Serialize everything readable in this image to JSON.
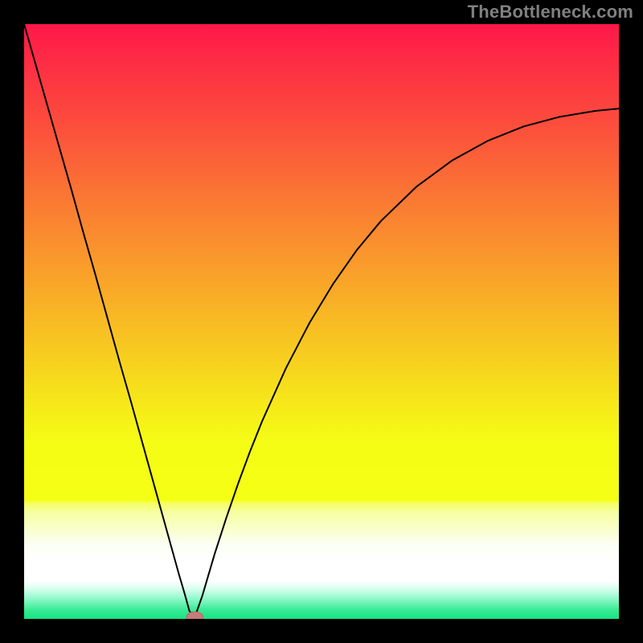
{
  "watermark": "TheBottleneck.com",
  "colors": {
    "curve": "#000000",
    "marker_fill": "#C47C7C",
    "marker_stroke": "#B86868",
    "frame": "#000000"
  },
  "chart_data": {
    "type": "line",
    "title": "",
    "xlabel": "",
    "ylabel": "",
    "xlim": [
      0,
      100
    ],
    "ylim": [
      0,
      100
    ],
    "grid": false,
    "legend": false,
    "gradient_stops": [
      {
        "offset": 0.0,
        "color": "#FE1749"
      },
      {
        "offset": 0.01,
        "color": "#FE1B48"
      },
      {
        "offset": 0.08,
        "color": "#FD3243"
      },
      {
        "offset": 0.17,
        "color": "#FC4E3C"
      },
      {
        "offset": 0.3,
        "color": "#FA7A33"
      },
      {
        "offset": 0.43,
        "color": "#F9A429"
      },
      {
        "offset": 0.55,
        "color": "#F7CB20"
      },
      {
        "offset": 0.7,
        "color": "#F5FC15"
      },
      {
        "offset": 0.8,
        "color": "#F5FF14"
      },
      {
        "offset": 0.805,
        "color": "#F5FF5F"
      },
      {
        "offset": 0.82,
        "color": "#F6FFA0"
      },
      {
        "offset": 0.855,
        "color": "#F9FFD5"
      },
      {
        "offset": 0.875,
        "color": "#FCFFF5"
      },
      {
        "offset": 0.905,
        "color": "#FFFFFF"
      },
      {
        "offset": 0.936,
        "color": "#FFFFFF"
      },
      {
        "offset": 0.95,
        "color": "#D5FFED"
      },
      {
        "offset": 0.967,
        "color": "#8CF8C8"
      },
      {
        "offset": 0.985,
        "color": "#37EB94"
      },
      {
        "offset": 1.0,
        "color": "#18E482"
      }
    ],
    "series": [
      {
        "name": "bottleneck-curve",
        "x": [
          0,
          2,
          4,
          6,
          8,
          10,
          12,
          14,
          16,
          18,
          20,
          22,
          24,
          26,
          27,
          27.8,
          28.7,
          30,
          32,
          34,
          36,
          38,
          40,
          44,
          48,
          52,
          56,
          60,
          66,
          72,
          78,
          84,
          90,
          96,
          100
        ],
        "y": [
          100,
          93,
          86,
          79,
          72,
          64.8,
          57.8,
          50.6,
          43.4,
          36.4,
          29.2,
          22,
          14.8,
          7.6,
          4.2,
          1.3,
          0.3,
          4,
          10.8,
          17,
          22.8,
          28.2,
          33.2,
          42.1,
          49.8,
          56.4,
          62.1,
          66.9,
          72.7,
          77.1,
          80.4,
          82.8,
          84.4,
          85.4,
          85.8
        ]
      }
    ],
    "marker": {
      "x": 28.7,
      "y": 0.3,
      "rx": 1.4,
      "ry": 0.9
    }
  }
}
